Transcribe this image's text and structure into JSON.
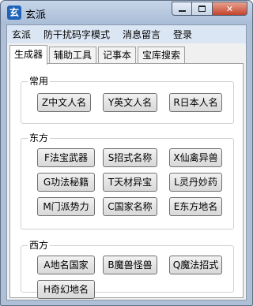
{
  "window": {
    "icon_text": "玄",
    "title": "玄派",
    "controls": {
      "close_glyph": "✕"
    }
  },
  "menu": [
    "玄派",
    "防干扰码字模式",
    "消息留言",
    "登录"
  ],
  "tabs": [
    "生成器",
    "辅助工具",
    "记事本",
    "宝库搜索"
  ],
  "groups": [
    {
      "label": "常用",
      "buttons": [
        "Z中文人名",
        "Y英文人名",
        "R日本人名"
      ]
    },
    {
      "label": "东方",
      "buttons": [
        "F法宝武器",
        "S招式名称",
        "X仙禽异兽",
        "G功法秘籍",
        "T天材异宝",
        "L灵丹妙药",
        "M门派势力",
        "C国家名称",
        "E东方地名"
      ]
    },
    {
      "label": "西方",
      "buttons": [
        "A地名国家",
        "B魔兽怪兽",
        "Q魔法招式",
        "H奇幻地名"
      ]
    }
  ]
}
